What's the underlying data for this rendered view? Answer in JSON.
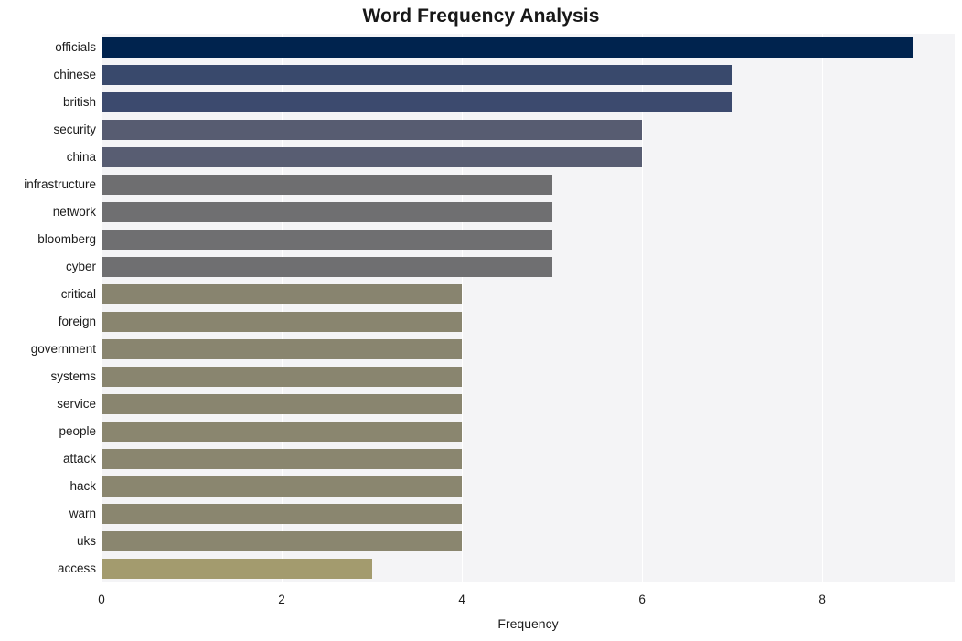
{
  "chart_data": {
    "type": "bar",
    "orientation": "horizontal",
    "title": "Word Frequency Analysis",
    "xlabel": "Frequency",
    "ylabel": "",
    "categories": [
      "officials",
      "chinese",
      "british",
      "security",
      "china",
      "infrastructure",
      "network",
      "bloomberg",
      "cyber",
      "critical",
      "foreign",
      "government",
      "systems",
      "service",
      "people",
      "attack",
      "hack",
      "warn",
      "uks",
      "access"
    ],
    "values": [
      9,
      7,
      7,
      6,
      6,
      5,
      5,
      5,
      5,
      4,
      4,
      4,
      4,
      4,
      4,
      4,
      4,
      4,
      4,
      3
    ],
    "xticks": [
      "0",
      "2",
      "4",
      "6",
      "8"
    ],
    "xtick_values": [
      0,
      2,
      4,
      6,
      8
    ],
    "xlim": [
      0,
      9.47
    ],
    "grid": "vertical",
    "legend": "none",
    "bar_colors": [
      "#00234e",
      "#39496c",
      "#3c4a6e",
      "#575c71",
      "#585d72",
      "#6e6e70",
      "#6f6f71",
      "#6f6f71",
      "#6f6f71",
      "#88846f",
      "#89856f",
      "#89856f",
      "#89856f",
      "#89856f",
      "#8a866f",
      "#8a866f",
      "#8a866f",
      "#8a866f",
      "#8a866f",
      "#a39b6e"
    ],
    "plot_background": "#f4f4f6",
    "figure_background": "#ffffff",
    "gridline_color": "#ffffff"
  }
}
